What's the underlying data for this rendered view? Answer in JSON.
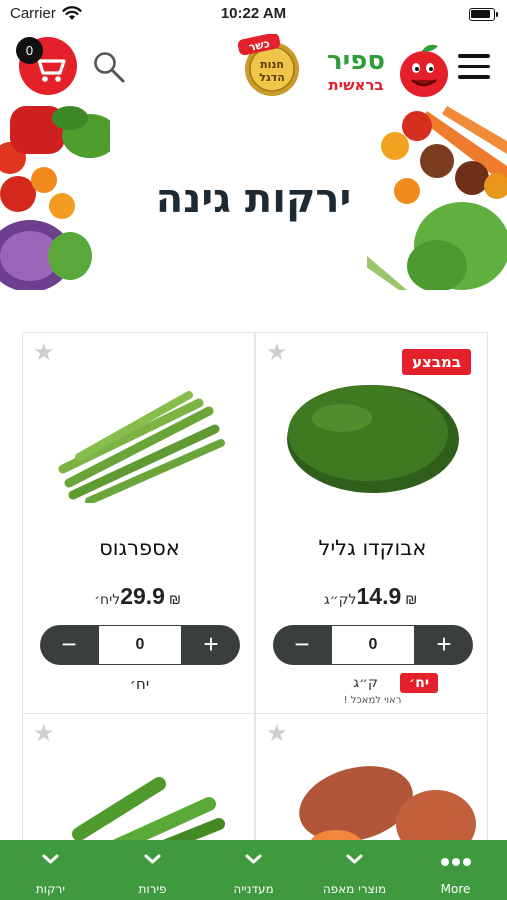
{
  "status_bar": {
    "carrier": "Carrier",
    "time": "10:22 AM"
  },
  "header": {
    "cart_count": "0",
    "logo": {
      "badge_top": "כשר",
      "badge_line1": "חנות",
      "badge_line2": "הדגל",
      "badge_ring": "מאז 1981",
      "brand_main": "ספיר",
      "brand_sub": "בראשית"
    }
  },
  "banner": {
    "title": "ירקות גינה"
  },
  "products": [
    {
      "name": "אבוקדו גליל",
      "price": "14.9",
      "currency": "₪",
      "unit": "לק״ג",
      "on_sale": true,
      "sale_label": "במבצע",
      "qty": "0",
      "unit_options": [
        "יח׳",
        "ק״ג"
      ],
      "unit_note": "ראוי למאכל !",
      "image": "avocado"
    },
    {
      "name": "אספרגוס",
      "price": "29.9",
      "currency": "₪",
      "unit": "ליח׳",
      "on_sale": false,
      "qty": "0",
      "unit_label": "יח׳",
      "image": "asparagus"
    },
    {
      "name": "",
      "image": "sweet-potato"
    },
    {
      "name": "",
      "image": "okra"
    }
  ],
  "stepper": {
    "minus": "−",
    "plus": "+"
  },
  "tabbar": {
    "accent": "#3f9a3f",
    "tabs": [
      {
        "label": "More",
        "icon": "more-dots-icon"
      },
      {
        "label": "מוצרי מאפה",
        "icon": "chevron-down-icon"
      },
      {
        "label": "מעדנייה",
        "icon": "chevron-down-icon"
      },
      {
        "label": "פירות",
        "icon": "chevron-down-icon"
      },
      {
        "label": "ירקות",
        "icon": "chevron-down-icon"
      }
    ]
  },
  "colors": {
    "brand_red": "#e4202a",
    "stepper_dark": "#3a3f3d",
    "title": "#1e2a33"
  }
}
